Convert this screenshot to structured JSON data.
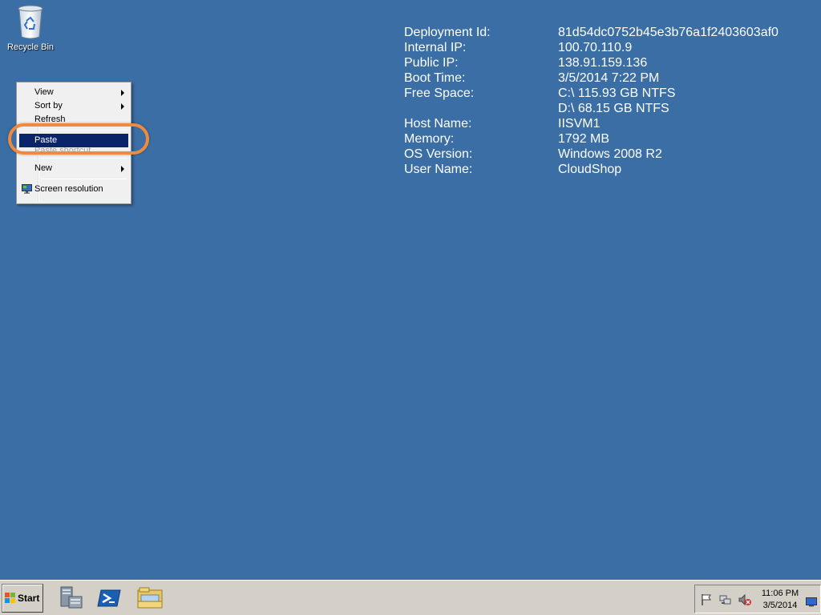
{
  "desktop": {
    "icons": [
      {
        "label": "Recycle Bin",
        "icon": "recycle-bin-icon"
      }
    ]
  },
  "info_panel": {
    "rows": [
      {
        "key": "Deployment Id:",
        "value": "81d54dc0752b45e3b76a1f2403603af0"
      },
      {
        "key": "Internal IP:",
        "value": "100.70.110.9"
      },
      {
        "key": "Public IP:",
        "value": "138.91.159.136"
      },
      {
        "key": "Boot Time:",
        "value": "3/5/2014 7:22 PM"
      },
      {
        "key": "Free Space:",
        "value": "C:\\ 115.93 GB NTFS"
      },
      {
        "key": "",
        "value": "D:\\ 68.15 GB NTFS"
      },
      {
        "key": "Host Name:",
        "value": "IISVM1"
      },
      {
        "key": "Memory:",
        "value": "1792 MB"
      },
      {
        "key": "OS Version:",
        "value": "Windows 2008 R2"
      },
      {
        "key": "User Name:",
        "value": "CloudShop"
      }
    ]
  },
  "context_menu": {
    "items": [
      {
        "label": "View",
        "submenu": true
      },
      {
        "label": "Sort by",
        "submenu": true
      },
      {
        "label": "Refresh",
        "submenu": false
      },
      {
        "label": "Paste",
        "submenu": false,
        "highlighted": true
      },
      {
        "label": "Paste shortcut",
        "submenu": false,
        "disabled": true
      },
      {
        "label": "New",
        "submenu": true
      },
      {
        "label": "Screen resolution",
        "submenu": false,
        "icon": "monitor-icon"
      }
    ]
  },
  "taskbar": {
    "start_label": "Start",
    "apps": [
      {
        "icon": "server-manager-icon"
      },
      {
        "icon": "powershell-icon"
      },
      {
        "icon": "windows-explorer-icon"
      }
    ],
    "tray_icons": [
      "action-center-flag-icon",
      "network-icon",
      "volume-muted-icon",
      "show-desktop-icon"
    ],
    "clock": {
      "time": "11:06 PM",
      "date": "3/5/2014"
    }
  },
  "colors": {
    "desktop_bg": "#3a6ea5",
    "menu_highlight": "#0a246a",
    "annotation_ring": "#f08a3c"
  }
}
